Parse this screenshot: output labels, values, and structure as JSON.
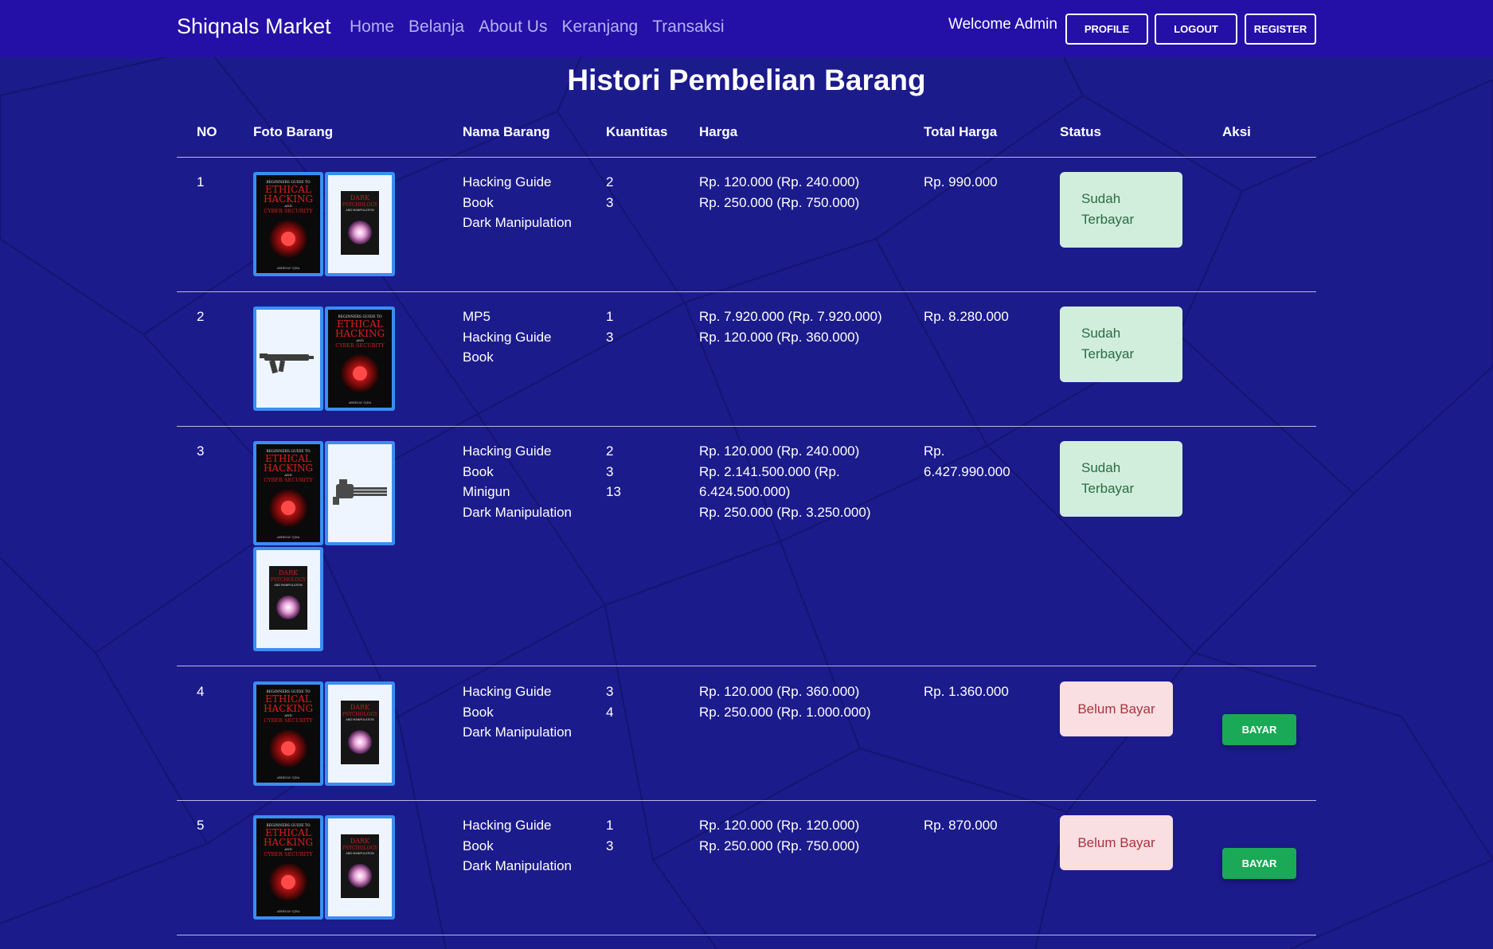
{
  "navbar": {
    "brand": "Shiqnals Market",
    "links": [
      "Home",
      "Belanja",
      "About Us",
      "Keranjang",
      "Transaksi"
    ],
    "welcome": "Welcome Admin",
    "profile_label": "PROFILE",
    "logout_label": "LOGOUT",
    "register_label": "REGISTER"
  },
  "page": {
    "title": "Histori Pembelian Barang"
  },
  "table": {
    "headers": [
      "NO",
      "Foto Barang",
      "Nama Barang",
      "Kuantitas",
      "Harga",
      "Total Harga",
      "Status",
      "Aksi"
    ],
    "rows": [
      {
        "no": "1",
        "photos": [
          "ethical-hacking-book",
          "dark-psychology-book"
        ],
        "names": [
          "Hacking Guide",
          "Book",
          "Dark Manipulation"
        ],
        "quantities": [
          "2",
          "3"
        ],
        "prices": [
          "Rp. 120.000 (Rp. 240.000)",
          "Rp. 250.000 (Rp. 750.000)"
        ],
        "total": "Rp. 990.000",
        "status": [
          "Sudah",
          "Terbayar"
        ],
        "status_type": "paid"
      },
      {
        "no": "2",
        "photos": [
          "mp5-gun",
          "ethical-hacking-book"
        ],
        "names": [
          "MP5",
          "Hacking Guide",
          "Book"
        ],
        "quantities": [
          "1",
          "3"
        ],
        "prices": [
          "Rp. 7.920.000 (Rp. 7.920.000)",
          "Rp. 120.000 (Rp. 360.000)"
        ],
        "total": "Rp. 8.280.000",
        "status": [
          "Sudah",
          "Terbayar"
        ],
        "status_type": "paid"
      },
      {
        "no": "3",
        "photos": [
          "ethical-hacking-book",
          "minigun",
          "dark-psychology-book"
        ],
        "names": [
          "Hacking Guide",
          "Book",
          "Minigun",
          "Dark Manipulation"
        ],
        "quantities": [
          "2",
          "3",
          "13"
        ],
        "prices": [
          "Rp. 120.000 (Rp. 240.000)",
          "Rp. 2.141.500.000 (Rp.",
          "6.424.500.000)",
          "Rp. 250.000 (Rp. 3.250.000)"
        ],
        "total": [
          "Rp.",
          "6.427.990.000"
        ],
        "status": [
          "Sudah",
          "Terbayar"
        ],
        "status_type": "paid"
      },
      {
        "no": "4",
        "photos": [
          "ethical-hacking-book",
          "dark-psychology-book"
        ],
        "names": [
          "Hacking Guide",
          "Book",
          "Dark Manipulation"
        ],
        "quantities": [
          "3",
          "4"
        ],
        "prices": [
          "Rp. 120.000 (Rp. 360.000)",
          "Rp. 250.000 (Rp. 1.000.000)"
        ],
        "total": "Rp. 1.360.000",
        "status": "Belum Bayar",
        "status_type": "unpaid",
        "action": "BAYAR"
      },
      {
        "no": "5",
        "photos": [
          "ethical-hacking-book",
          "dark-psychology-book"
        ],
        "names": [
          "Hacking Guide",
          "Book",
          "Dark Manipulation"
        ],
        "quantities": [
          "1",
          "3"
        ],
        "prices": [
          "Rp. 120.000 (Rp. 120.000)",
          "Rp. 250.000 (Rp. 750.000)"
        ],
        "total": "Rp. 870.000",
        "status": "Belum Bayar",
        "status_type": "unpaid",
        "action": "BAYAR"
      }
    ]
  },
  "book_covers": {
    "ethical_hacking": {
      "top": "BEGINNERS GUIDE TO",
      "line1": "ETHICAL",
      "line2": "HACKING",
      "and": "AND",
      "line3": "CYBER SECURITY",
      "author": "ABHINAV OJHA"
    },
    "dark_psychology": {
      "line1": "DARK",
      "line2": "PSYCHOLOGY",
      "line3": "AND MANIPULATION"
    }
  },
  "colors": {
    "navbar": "#2410a6",
    "background": "#1c1b8c",
    "thumb_border": "#3a8ef2",
    "paid_bg": "#d1eedc",
    "unpaid_bg": "#fadfe2",
    "bayar": "#1aa956"
  }
}
